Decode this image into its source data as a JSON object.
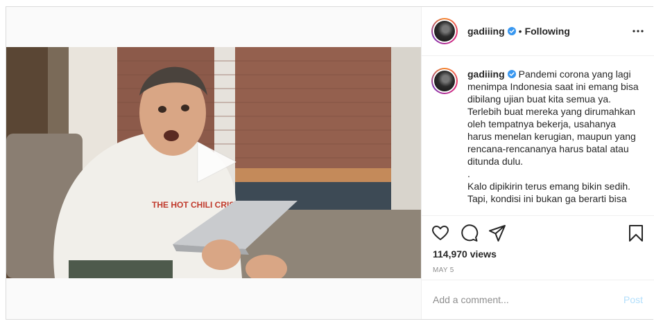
{
  "post": {
    "username": "gadiiing",
    "follow_separator": "•",
    "follow_status": "Following",
    "caption": "Pandemi corona yang lagi menimpa Indonesia saat ini emang bisa dibilang ujian buat kita semua ya. Terlebih buat mereka yang dirumahkan oleh tempatnya bekerja, usahanya harus menelan kerugian, maupun yang rencana-rencananya harus batal atau ditunda dulu.\n.\nKalo dipikirin terus emang bikin sedih. Tapi, kondisi ini bukan ga berarti bisa",
    "views": "114,970 views",
    "date": "MAY 5",
    "video_shirt_text": "THE HOT CHILI CRISP"
  },
  "comment": {
    "placeholder": "Add a comment...",
    "post_label": "Post"
  },
  "colors": {
    "verified": "#3897f0",
    "post_disabled": "#b2dffc",
    "muted": "#8e8e8e",
    "text": "#262626",
    "border": "#dbdbdb"
  },
  "icons": [
    "play-icon",
    "verified-icon",
    "more-options-icon",
    "heart-icon",
    "comment-icon",
    "share-icon",
    "save-bookmark-icon"
  ]
}
